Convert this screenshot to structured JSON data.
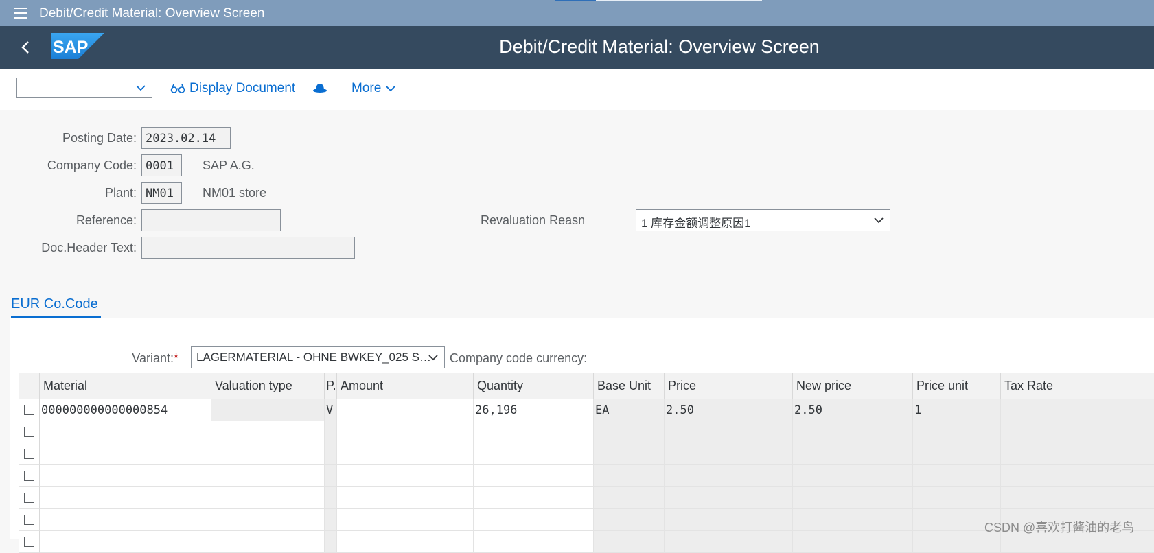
{
  "titlebar": {
    "title": "Debit/Credit Material: Overview Screen"
  },
  "shell": {
    "title": "Debit/Credit Material: Overview Screen",
    "logo_text": "SAP"
  },
  "toolbar": {
    "select_value": "",
    "display_document": "Display Document",
    "more": "More"
  },
  "form": {
    "posting_date": {
      "label": "Posting Date:",
      "value": "2023.02.14"
    },
    "company_code": {
      "label": "Company Code:",
      "value": "0001",
      "desc": "SAP A.G."
    },
    "plant": {
      "label": "Plant:",
      "value": "NM01",
      "desc": "NM01 store"
    },
    "reference": {
      "label": "Reference:",
      "value": ""
    },
    "doc_header_text": {
      "label": "Doc.Header Text:",
      "value": ""
    },
    "revaluation_reason": {
      "label": "Revaluation Reasn",
      "value": "1 库存金额调整原因1"
    }
  },
  "tabs": [
    {
      "label": "EUR  Co.Code"
    }
  ],
  "variant": {
    "label": "Variant:",
    "required_mark": "*",
    "value": "LAGERMATERIAL - OHNE BWKEY_025 S…",
    "currency_label": "Company code currency:"
  },
  "table": {
    "columns": [
      "Material",
      "Valuation type",
      "P.",
      "Amount",
      "Quantity",
      "Base Unit",
      "Price",
      "New price",
      "Price unit",
      "Tax Rate"
    ],
    "rows": [
      {
        "material": "000000000000000854",
        "valuation_type": "",
        "p": "V",
        "amount": "",
        "quantity": "26,196",
        "base_unit": "EA",
        "price": "2.50",
        "new_price": "2.50",
        "price_unit": "1",
        "tax_rate": ""
      }
    ],
    "empty_rows": 6
  },
  "watermark": "CSDN @喜欢打酱油的老鸟",
  "colors": {
    "shell": "#354a5f",
    "titlebar": "#7f9cbb",
    "accent": "#0a6ed1"
  }
}
